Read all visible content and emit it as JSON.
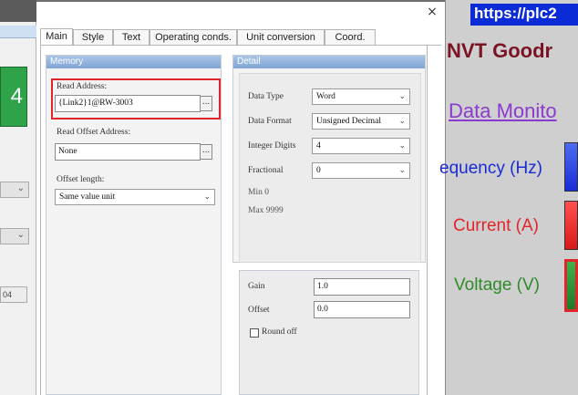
{
  "left_panel": {
    "preview_value": "4",
    "field_value": "04"
  },
  "dialog": {
    "close_symbol": "×",
    "tabs": [
      {
        "label": "Main",
        "active": true
      },
      {
        "label": "Style",
        "active": false
      },
      {
        "label": "Text",
        "active": false
      },
      {
        "label": "Operating conds.",
        "active": false
      },
      {
        "label": "Unit conversion",
        "active": false
      },
      {
        "label": "Coord.",
        "active": false
      }
    ],
    "memory": {
      "header": "Memory",
      "read_address_label": "Read Address:",
      "read_address_value": "{Link2}1@RW-3003",
      "read_offset_label": "Read Offset Address:",
      "read_offset_value": "None",
      "offset_length_label": "Offset length:",
      "offset_length_value": "Same value unit",
      "browse_label": "..."
    },
    "detail": {
      "header": "Detail",
      "data_type_label": "Data Type",
      "data_type_value": "Word",
      "data_format_label": "Data Format",
      "data_format_value": "Unsigned Decimal",
      "integer_digits_label": "Integer Digits",
      "integer_digits_value": "4",
      "fractional_label": "Fractional",
      "fractional_value": "0",
      "min_text": "Min 0",
      "max_text": "Max 9999"
    },
    "scaling": {
      "gain_label": "Gain",
      "gain_value": "1.0",
      "offset_label": "Offset",
      "offset_value": "0.0",
      "round_off_label": "Round off",
      "round_off_checked": false
    }
  },
  "web_page": {
    "url_text": "https://plc2",
    "site_title": "NVT Goodr",
    "monitor_link": "Data Monito",
    "labels": [
      {
        "text": "equency (Hz)",
        "color": "#1a2bd6"
      },
      {
        "text": "Current (A)",
        "color": "#e0252b"
      },
      {
        "text": "Voltage (V)",
        "color": "#2f8a2a"
      }
    ]
  },
  "colors": {
    "highlight": "#e0252b",
    "group_header": "#8fb0dc",
    "url_bar": "#0a2bd6"
  }
}
